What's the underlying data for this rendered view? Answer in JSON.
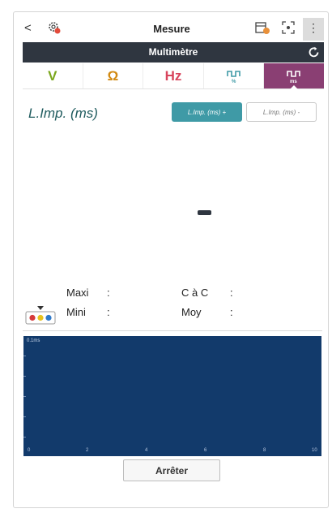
{
  "appbar": {
    "back_label": "<",
    "title": "Mesure",
    "more_label": "⋮"
  },
  "subheader": {
    "title": "Multimètre"
  },
  "tabs": [
    {
      "label": "V",
      "icon": "volt",
      "color": "#7aa61b"
    },
    {
      "label": "Ω",
      "icon": "ohm",
      "color": "#d28a12"
    },
    {
      "label": "Hz",
      "icon": "frequency",
      "color": "#d8455d"
    },
    {
      "label": "%",
      "icon": "duty-cycle-icon",
      "color": "#3f9aa6"
    },
    {
      "label": "ms",
      "icon": "pulse-width-icon",
      "active": true,
      "color": "#8a3f73"
    }
  ],
  "measure": {
    "title": "L.Imp. (ms)",
    "toggle_positive": "L.Imp. (ms) +",
    "toggle_negative": "L.Imp. (ms) -",
    "reading": "-"
  },
  "stats": {
    "maxi_label": "Maxi",
    "mini_label": "Mini",
    "cac_label": "C à C",
    "moy_label": "Moy",
    "colon": ":"
  },
  "scope": {
    "y_label": "0.1ms",
    "x_ticks": [
      "0",
      "2",
      "4",
      "6",
      "8",
      "10"
    ],
    "background": "#123a6b"
  },
  "actions": {
    "stop_label": "Arrêter"
  }
}
